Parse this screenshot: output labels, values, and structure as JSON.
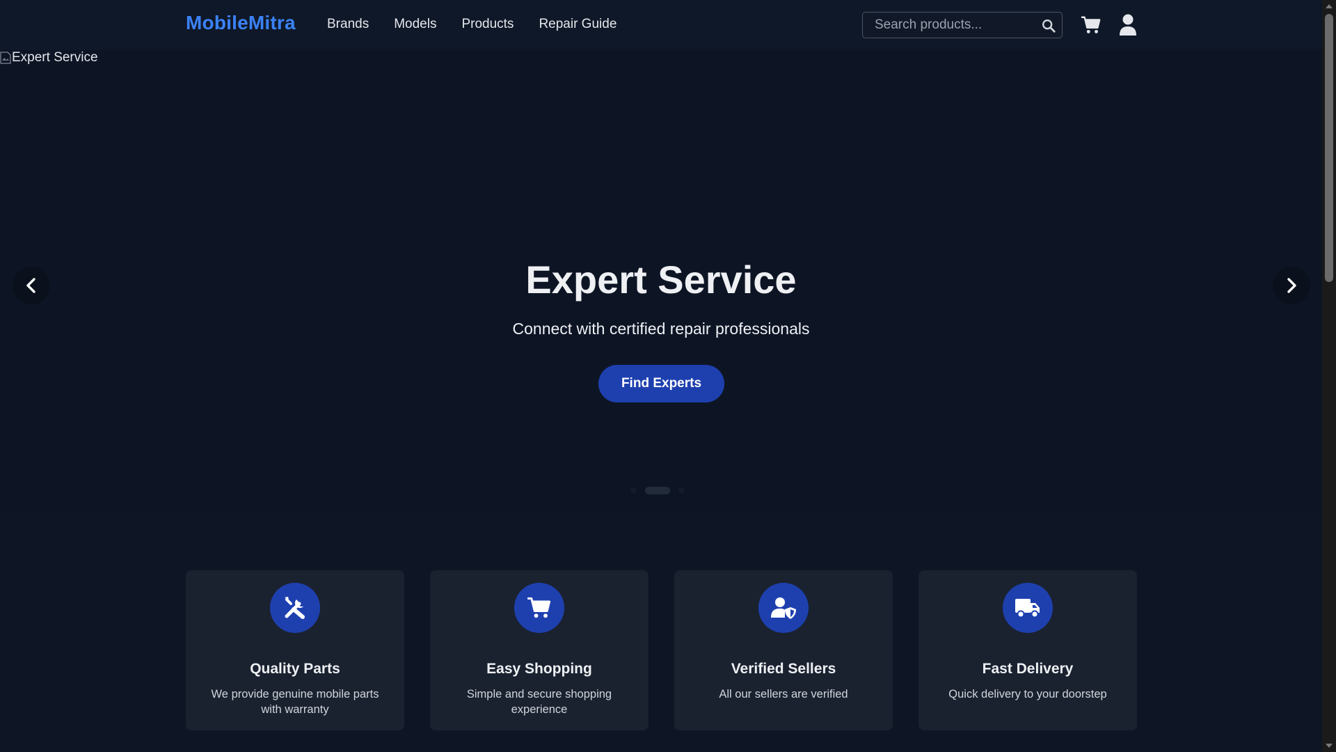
{
  "navbar": {
    "logo": "MobileMitra",
    "links": [
      "Brands",
      "Models",
      "Products",
      "Repair Guide"
    ],
    "search_placeholder": "Search products...",
    "icons": [
      "search-icon",
      "cart-icon",
      "user-icon"
    ]
  },
  "hero": {
    "image_alt": "Expert Service",
    "title": "Expert Service",
    "subtitle": "Connect with certified repair professionals",
    "button_label": "Find Experts",
    "slide_count": 3,
    "active_slide": 2
  },
  "features": [
    {
      "icon": "tools-icon",
      "title": "Quality Parts",
      "description": "We provide genuine mobile parts with warranty"
    },
    {
      "icon": "cart-icon",
      "title": "Easy Shopping",
      "description": "Simple and secure shopping experience"
    },
    {
      "icon": "user-shield-icon",
      "title": "Verified Sellers",
      "description": "All our sellers are verified"
    },
    {
      "icon": "truck-icon",
      "title": "Fast Delivery",
      "description": "Quick delivery to your doorstep"
    }
  ],
  "colors": {
    "background": "#0e1626",
    "accent": "#1e40af",
    "logo": "#3b82f6",
    "card": "#1a2230"
  }
}
